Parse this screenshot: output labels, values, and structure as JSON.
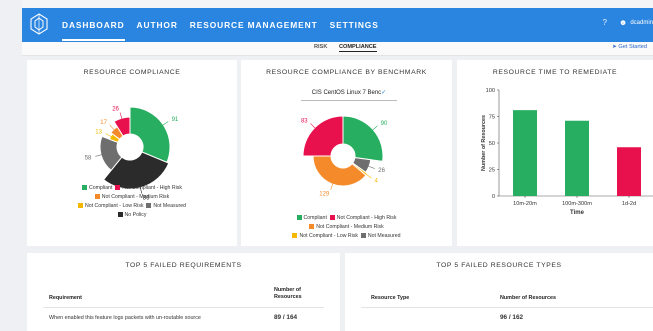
{
  "nav": {
    "items": [
      "DASHBOARD",
      "AUTHOR",
      "RESOURCE MANAGEMENT",
      "SETTINGS"
    ],
    "help": "?",
    "user": "dcadmin"
  },
  "subtabs": {
    "risk": "RISK",
    "compliance": "COMPLIANCE",
    "get_started": "Get Started"
  },
  "colors": {
    "accent": "#2a85e0",
    "compliant": "#27ae60",
    "high": "#e8114e",
    "medium": "#f58a2a",
    "low": "#f5b800",
    "not_measured": "#6e6e6e",
    "no_policy": "#2b2b2b"
  },
  "card1": {
    "title": "RESOURCE COMPLIANCE",
    "labels": {
      "compliant": "91",
      "high": "26",
      "medium": "17",
      "low": "13",
      "not_measured": "58",
      "no_policy": "86"
    },
    "legend": [
      "Compliant",
      "Not Compliant - High Risk",
      "Not Compliant - Medium Risk",
      "Not Compliant - Low Risk",
      "Not Measured",
      "No Policy"
    ]
  },
  "card2": {
    "title": "RESOURCE COMPLIANCE BY BENCHMARK",
    "benchmark": "CIS CentOS Linux 7 Benc",
    "labels": {
      "compliant": "90",
      "high": "83",
      "medium": "129",
      "low": "4",
      "not_measured": "26"
    },
    "legend": [
      "Compliant",
      "Not Compliant - High Risk",
      "Not Compliant - Medium Risk",
      "Not Compliant - Low Risk",
      "Not Measured"
    ]
  },
  "card3": {
    "title": "RESOURCE TIME TO REMEDIATE"
  },
  "chart_data": {
    "type": "bar",
    "categories": [
      "10m-20m",
      "100m-300m",
      "1d-2d"
    ],
    "values": [
      81,
      71,
      46
    ],
    "colors": [
      "#27ae60",
      "#27ae60",
      "#e8114e"
    ],
    "xlabel": "Time",
    "ylabel": "Number of Resources",
    "ylim": [
      0,
      100
    ],
    "yticks": [
      "0",
      "25",
      "50",
      "75",
      "100"
    ]
  },
  "card4": {
    "title": "TOP 5 FAILED REQUIREMENTS",
    "col1": "Requirement",
    "col2": "Number of Resources",
    "row1_text": "When enabled this feature logs packets with un-routable source",
    "row1_value": "89 / 164"
  },
  "card5": {
    "title": "TOP 5 FAILED RESOURCE TYPES",
    "col1": "Resource Type",
    "col2": "Number of Resources",
    "row1_value": "96 / 162"
  }
}
